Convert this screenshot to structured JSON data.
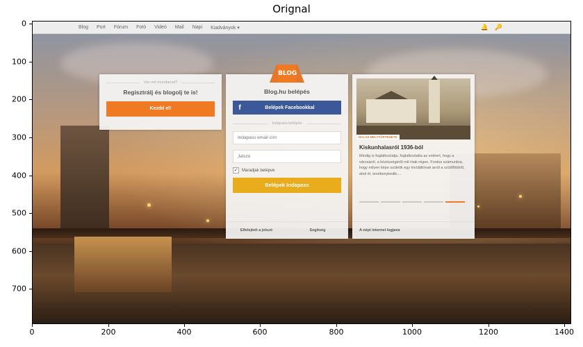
{
  "plot": {
    "title": "Orignal"
  },
  "axes": {
    "x_ticks": [
      "0",
      "200",
      "400",
      "600",
      "800",
      "1000",
      "1200",
      "1400"
    ],
    "y_ticks": [
      "0",
      "100",
      "200",
      "300",
      "400",
      "500",
      "600",
      "700"
    ]
  },
  "topnav": {
    "links": [
      "Blog",
      "Port",
      "Fórum",
      "Fotó",
      "Videó",
      "Mail",
      "Napi",
      "Kiadványok ▾"
    ],
    "icons": [
      "bell-icon",
      "key-icon"
    ]
  },
  "register": {
    "caption": "Van mit mondanod?",
    "heading": "Regisztrálj és blogolj te is!",
    "button": "Kezdd el!"
  },
  "logo": {
    "text": "BLOG"
  },
  "login": {
    "title": "Blog.hu belépés",
    "facebook_button": "Belépek Facebookkal",
    "indapass_caption": "Indapass belépés",
    "email_placeholder": "Indapass email cím",
    "password_placeholder": "Jelszó",
    "remember_label": "Maradjak belépve",
    "remember_checked": true,
    "submit_button": "Belépek Indapass",
    "forgot_link": "Elfelejtett a jelszó",
    "help_link": "Segítség"
  },
  "article": {
    "badge": "HALAS HELYTÖRTÉNETE",
    "title": "Kiskunhalasról 1936-ból",
    "body": "Mindig is foglalkoztatja, foglalkoztatta az embert, hogy a városáról, a közösségéről mit írtak régen. Fontos számunkra, hogy milyen képe születik egy kívülállónak arról a szülőföldről, ahol él, tevékenykedik....",
    "pager_count": 5,
    "pager_active": 5,
    "footer": "A népi internet legjava"
  },
  "colors": {
    "orange": "#f07a24",
    "facebook": "#3b5998",
    "yellow": "#e9ac1c"
  }
}
